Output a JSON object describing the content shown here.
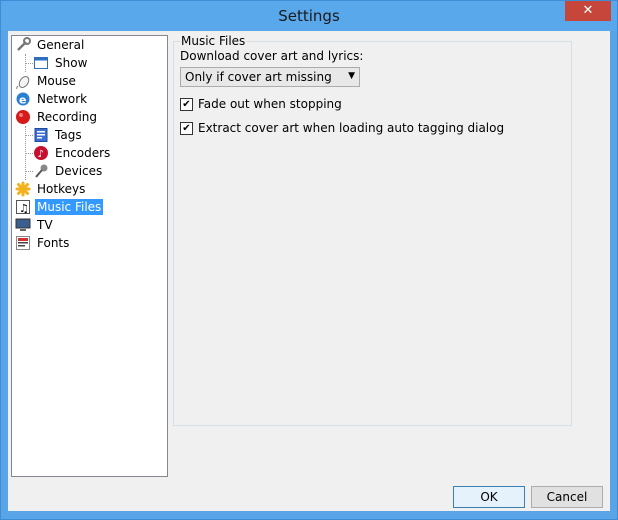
{
  "window": {
    "title": "Settings",
    "close_glyph": "✕"
  },
  "tree": {
    "items": [
      {
        "label": "General",
        "icon": "wrench-icon"
      },
      {
        "label": "Show",
        "icon": "window-icon"
      },
      {
        "label": "Mouse",
        "icon": "mouse-icon"
      },
      {
        "label": "Network",
        "icon": "network-icon"
      },
      {
        "label": "Recording",
        "icon": "record-icon"
      },
      {
        "label": "Tags",
        "icon": "tags-icon"
      },
      {
        "label": "Encoders",
        "icon": "encoders-icon"
      },
      {
        "label": "Devices",
        "icon": "microphone-icon"
      },
      {
        "label": "Hotkeys",
        "icon": "hotkeys-icon"
      },
      {
        "label": "Music Files",
        "icon": "music-note-icon"
      },
      {
        "label": "TV",
        "icon": "tv-icon"
      },
      {
        "label": "Fonts",
        "icon": "fonts-icon"
      }
    ],
    "selected": "Music Files"
  },
  "panel": {
    "title": "Music Files",
    "download_label": "Download cover art and lyrics:",
    "download_selected": "Only if cover art missing",
    "fade_out_label": "Fade out when stopping",
    "fade_out_checked": true,
    "extract_label": "Extract cover art when loading auto tagging dialog",
    "extract_checked": true
  },
  "buttons": {
    "ok": "OK",
    "cancel": "Cancel"
  },
  "colors": {
    "accent": "#3399ff",
    "titlebar": "#5aa8ec",
    "close": "#c7463b"
  }
}
